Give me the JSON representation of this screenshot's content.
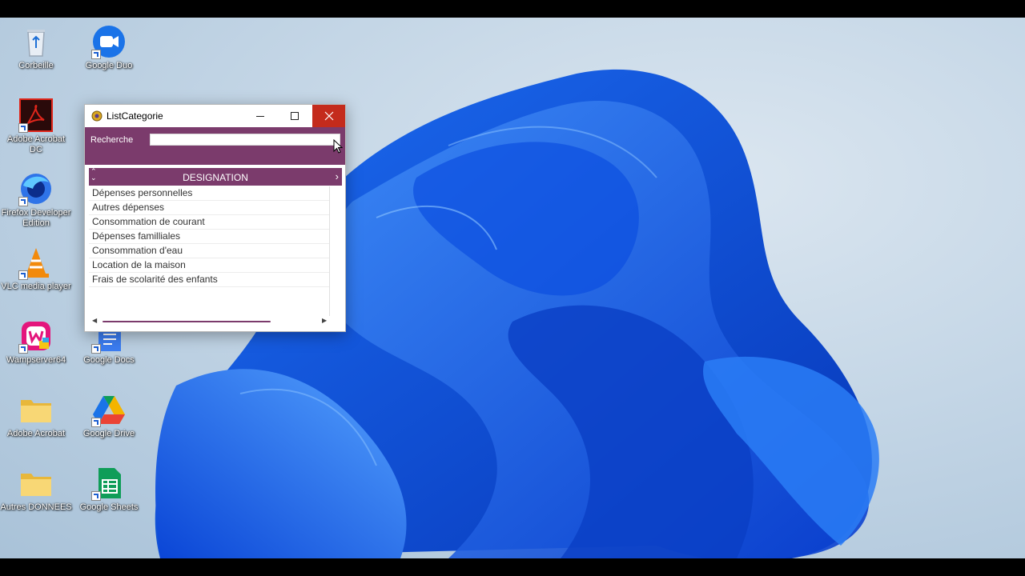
{
  "desktop": {
    "icons": [
      {
        "label": "Corbeille",
        "icon": "recycle-bin-icon"
      },
      {
        "label": "Google Duo",
        "icon": "google-duo-icon"
      },
      {
        "label": "Adobe Acrobat DC",
        "icon": "acrobat-icon"
      },
      {
        "label": "Firefox Developer Edition",
        "icon": "firefox-icon"
      },
      {
        "label": "VLC media player",
        "icon": "vlc-icon"
      },
      {
        "label": "Wampserver64",
        "icon": "wampserver-icon"
      },
      {
        "label": "Google Docs",
        "icon": "google-docs-icon"
      },
      {
        "label": "Adobe Acrobat",
        "icon": "folder-icon"
      },
      {
        "label": "Google Drive",
        "icon": "google-drive-icon"
      },
      {
        "label": "Autres DONNEES",
        "icon": "folder-icon"
      },
      {
        "label": "Google Sheets",
        "icon": "google-sheets-icon"
      }
    ]
  },
  "window": {
    "title": "ListCategorie",
    "accent_color": "#7b3b6c",
    "close_color": "#c42b1c",
    "search": {
      "label": "Recherche",
      "value": ""
    },
    "grid": {
      "column_header": "DESIGNATION",
      "rows": [
        "Dépenses personnelles",
        "Autres dépenses",
        "Consommation de courant",
        "Dépenses familliales",
        "Consommation d'eau",
        "Location de la maison",
        "Frais de scolarité des enfants"
      ]
    }
  }
}
